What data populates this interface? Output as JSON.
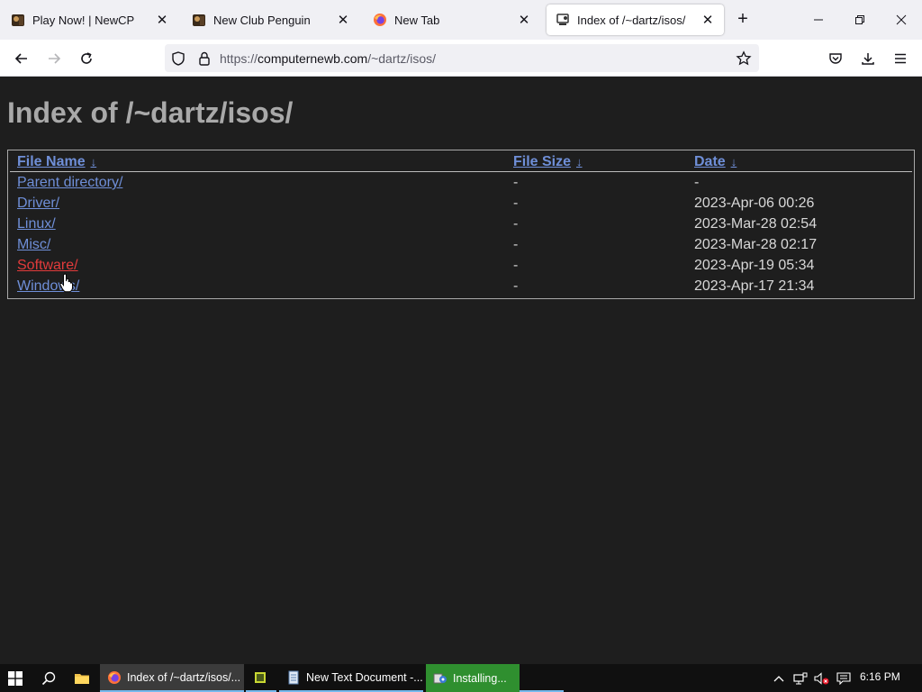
{
  "browser": {
    "tabs": [
      {
        "label": "Play Now! | NewCP",
        "active": false
      },
      {
        "label": "New Club Penguin",
        "active": false
      },
      {
        "label": "New Tab",
        "active": false
      },
      {
        "label": "Index of /~dartz/isos/",
        "active": true
      }
    ],
    "url": {
      "prefix": "https://",
      "host": "computernewb.com",
      "path": "/~dartz/isos/"
    }
  },
  "page": {
    "title": "Index of /~dartz/isos/",
    "columns": [
      {
        "label": "File Name",
        "arrow": "↓"
      },
      {
        "label": "File Size",
        "arrow": "↓"
      },
      {
        "label": "Date",
        "arrow": "↓"
      }
    ],
    "rows": [
      {
        "name": "Parent directory/",
        "size": "-",
        "date": "-",
        "hover": false
      },
      {
        "name": "Driver/",
        "size": "-",
        "date": "2023-Apr-06 00:26",
        "hover": false
      },
      {
        "name": "Linux/",
        "size": "-",
        "date": "2023-Mar-28 02:54",
        "hover": false
      },
      {
        "name": "Misc/",
        "size": "-",
        "date": "2023-Mar-28 02:17",
        "hover": false
      },
      {
        "name": "Software/",
        "size": "-",
        "date": "2023-Apr-19 05:34",
        "hover": true
      },
      {
        "name": "Windows/",
        "size": "-",
        "date": "2023-Apr-17 21:34",
        "hover": false
      }
    ]
  },
  "taskbar": {
    "apps": [
      {
        "label": "Index of /~dartz/isos/...",
        "icon": "firefox-icon",
        "state": "active"
      },
      {
        "label": "",
        "icon": "notebook-icon",
        "state": "normal"
      },
      {
        "label": "New Text Document -...",
        "icon": "notepad-icon",
        "state": "normal"
      },
      {
        "label": "Installing...",
        "icon": "installer-icon",
        "state": "progress"
      }
    ],
    "clock": "6:16 PM"
  },
  "colors": {
    "page_bg": "#1e1e1e",
    "link": "#6f8fd8",
    "link_hover": "#e23b3b",
    "title": "#a9a9a9",
    "taskbar_accent": "#76b9ed",
    "progress": "#2f8f2f"
  }
}
